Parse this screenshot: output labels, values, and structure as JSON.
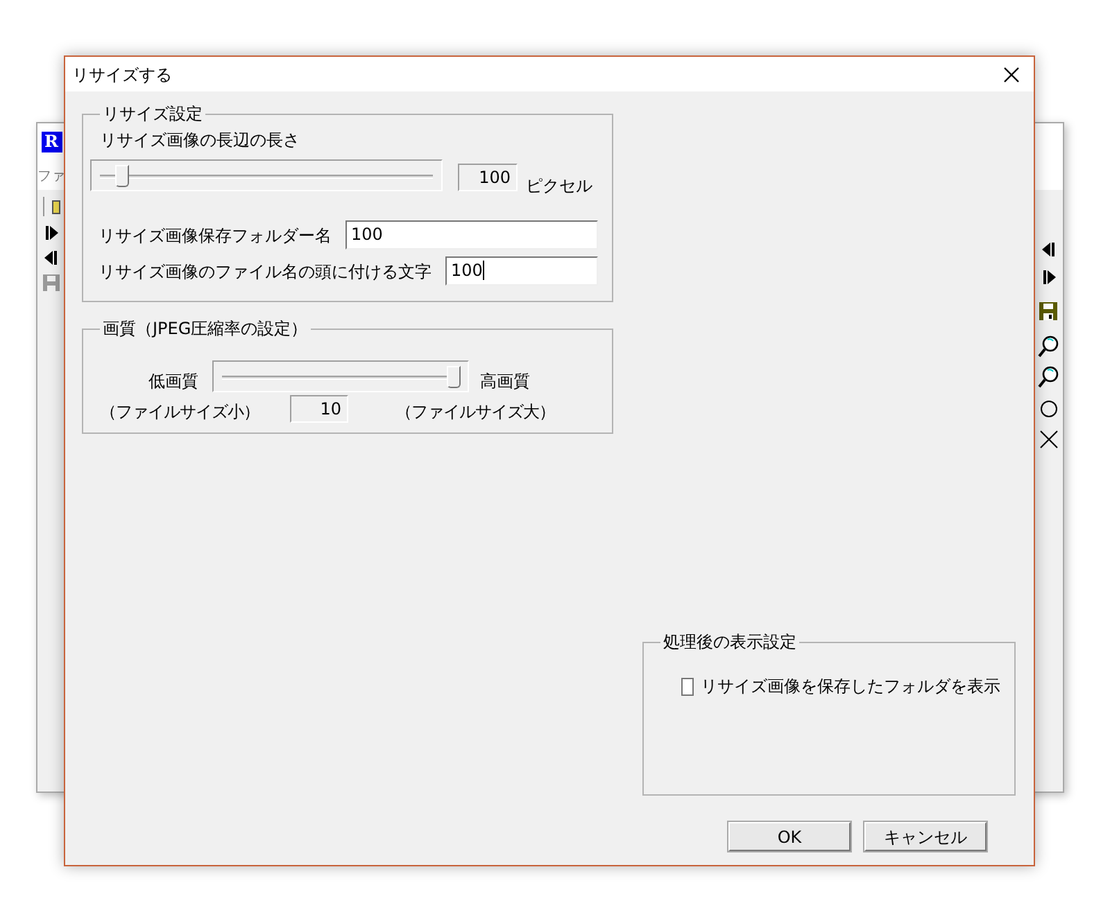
{
  "background_window": {
    "logo": "R",
    "menu": [
      "ファ"
    ]
  },
  "window": {
    "title": "リサイズする"
  },
  "resize_settings": {
    "legend": "リサイズ設定",
    "long_side": {
      "label": "リサイズ画像の長辺の長さ",
      "level": 0.05,
      "value": "100",
      "unit": "ピクセル"
    },
    "fields": [
      {
        "label": "リサイズ画像保存フォルダー名",
        "value": "100",
        "focused": false
      },
      {
        "label": "リサイズ画像のファイル名の頭に付ける文字",
        "value": "100",
        "focused": true
      }
    ]
  },
  "quality": {
    "legend": "画質（JPEG圧縮率の設定）",
    "low_label": "低画質",
    "high_label": "高画質",
    "level": 1,
    "value": "10",
    "low_note": "（ファイルサイズ小）",
    "high_note": "（ファイルサイズ大）"
  },
  "after_processing": {
    "legend": "処理後の表示設定",
    "checkbox": {
      "label": "リサイズ画像を保存したフォルダを表示",
      "checked": false
    }
  },
  "buttons": [
    "OK",
    "キャンセル"
  ]
}
